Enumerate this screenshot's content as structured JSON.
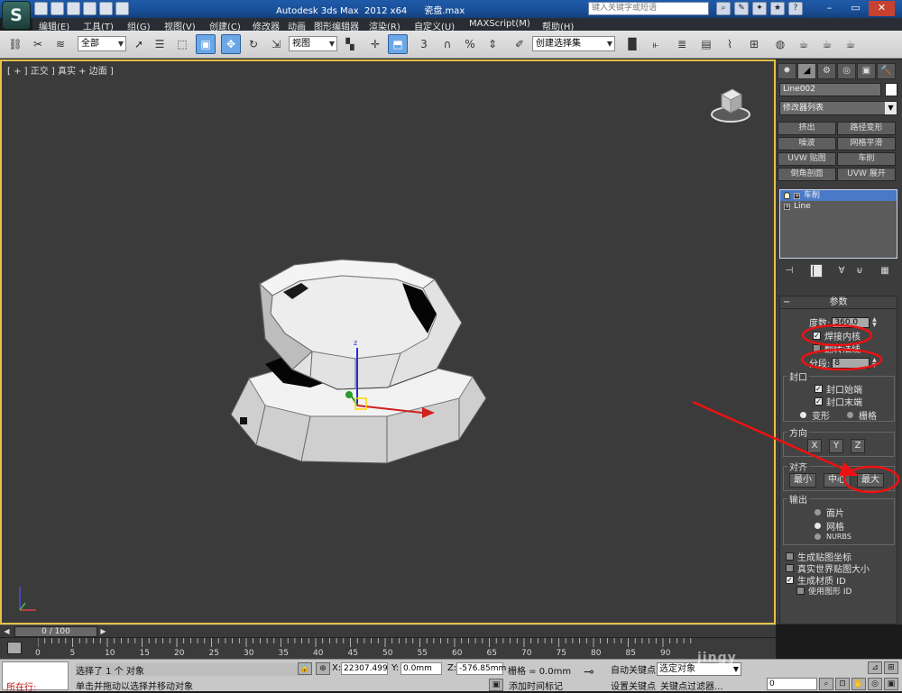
{
  "app": {
    "title": "Autodesk 3ds Max  2012 x64      瓷盘.max",
    "logo_letter": "S",
    "help_search_placeholder": "键入关键字或短语"
  },
  "menu": [
    "编辑(E)",
    "工具(T)",
    "组(G)",
    "视图(V)",
    "创建(C)",
    "修改器",
    "动画",
    "图形编辑器",
    "渲染(R)",
    "自定义(U)",
    "MAXScript(M)",
    "帮助(H)"
  ],
  "toolbar": {
    "selection_filter": "全部",
    "ref_coord": "视图",
    "named_selection": "创建选择集",
    "snap_label": "3",
    "percent_label": "%"
  },
  "viewport": {
    "label": "[ + ] 正交 ] 真实 + 边面 ]"
  },
  "command_panel": {
    "tabs": [
      "✸",
      "◢",
      "⚙",
      "◎",
      "▣",
      "🔨"
    ],
    "object_name": "Line002",
    "modifier_list": "修改器列表",
    "modifier_buttons": [
      [
        "挤出",
        "路径变形"
      ],
      [
        "噪波",
        "网格平滑"
      ],
      [
        "UVW 贴图",
        "车削"
      ],
      [
        "倒角剖面",
        "UVW 展开"
      ]
    ],
    "stack": [
      {
        "label": "车削",
        "selected": true
      },
      {
        "label": "Line",
        "selected": false
      }
    ],
    "params": {
      "header": "参数",
      "degrees_label": "度数:",
      "degrees_value": "360.0",
      "weld_core_label": "焊接内核",
      "flip_normals_label": "翻转法线",
      "segments_label": "分段:",
      "segments_value": "8",
      "cap_group": "封口",
      "cap_start": "封口始端",
      "cap_end": "封口末端",
      "morph": "变形",
      "grid": "栅格",
      "direction_group": "方向",
      "dir_x": "X",
      "dir_y": "Y",
      "dir_z": "Z",
      "align_group": "对齐",
      "align_min": "最小",
      "align_center": "中心",
      "align_max": "最大",
      "output_group": "输出",
      "out_patch": "面片",
      "out_mesh": "网格",
      "out_nurbs": "NURBS",
      "gen_map_coords": "生成贴图坐标",
      "real_world_map": "真实世界贴图大小",
      "gen_mat_ids": "生成材质 ID",
      "use_shape_ids": "使用图形 ID"
    }
  },
  "timeline": {
    "frame_indicator": "0 / 100",
    "ticks": [
      "0",
      "5",
      "10",
      "15",
      "20",
      "25",
      "30",
      "35",
      "40",
      "45",
      "50",
      "55",
      "60",
      "65",
      "70",
      "75",
      "80",
      "85",
      "90"
    ]
  },
  "status": {
    "running_label": "所在行:",
    "selected_text": "选择了 1 个 对象",
    "prompt_text": "单击并拖动以选择并移动对象",
    "x_label": "X:",
    "x_value": "22307.499",
    "y_label": "Y:",
    "y_value": "0.0mm",
    "z_label": "Z:",
    "z_value": "-576.85mm",
    "grid_text": "栅格 = 0.0mm",
    "autokey": "自动关键点",
    "setkey": "设置关键点",
    "selected_object_dd": "选定对象",
    "key_filters": "关键点过滤器...",
    "add_time_tag": "添加时间标记",
    "frame_value": "0"
  },
  "watermark": "jingy"
}
